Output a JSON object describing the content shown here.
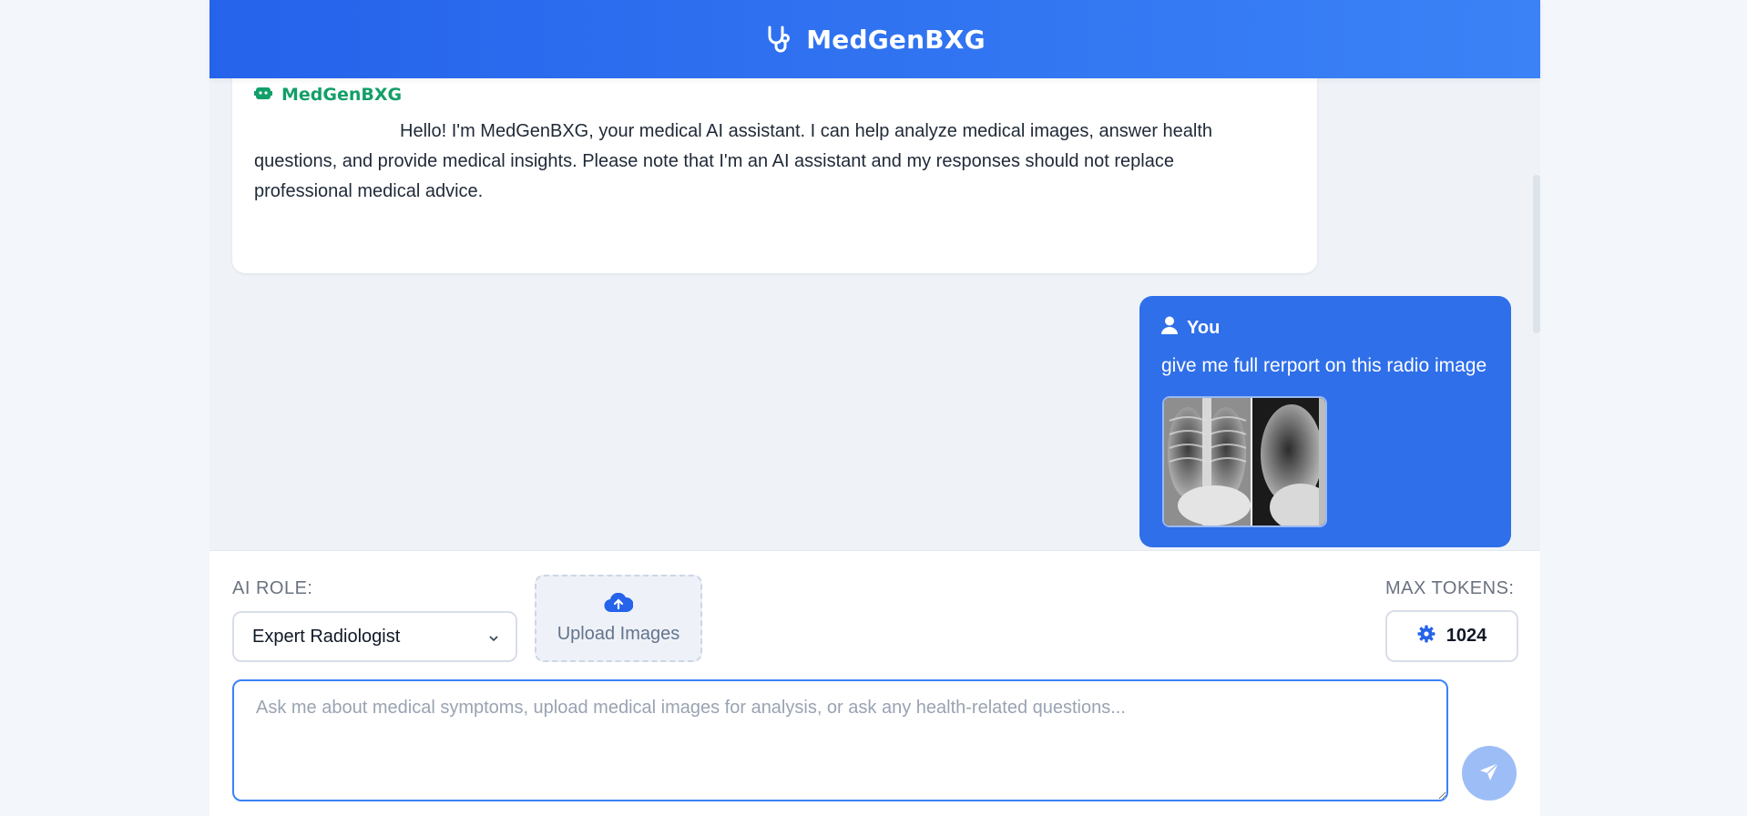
{
  "header": {
    "title": "MedGenBXG",
    "icon": "stethoscope-icon"
  },
  "chat": {
    "bot": {
      "name": "MedGenBXG",
      "icon": "robot-icon",
      "text": "Hello! I'm MedGenBXG, your medical AI assistant. I can help analyze medical images, answer health questions, and provide medical insights. Please note that I'm an AI assistant and my responses should not replace professional medical advice."
    },
    "user": {
      "name": "You",
      "icon": "user-icon",
      "text": "give me full rerport on this radio image",
      "attachment": "chest x-ray image"
    }
  },
  "controls": {
    "role_label": "AI ROLE:",
    "role_value": "Expert Radiologist",
    "upload_label": "Upload Images",
    "tokens_label": "MAX TOKENS:",
    "tokens_value": "1024",
    "input_placeholder": "Ask me about medical symptoms, upload medical images for analysis, or ask any health-related questions...",
    "input_value": ""
  },
  "colors": {
    "header_gradient_start": "#2563eb",
    "header_gradient_end": "#3b82f6",
    "bot_name": "#129f68",
    "user_bubble": "#2f6fe9",
    "send_button": "#9dbdf7"
  }
}
